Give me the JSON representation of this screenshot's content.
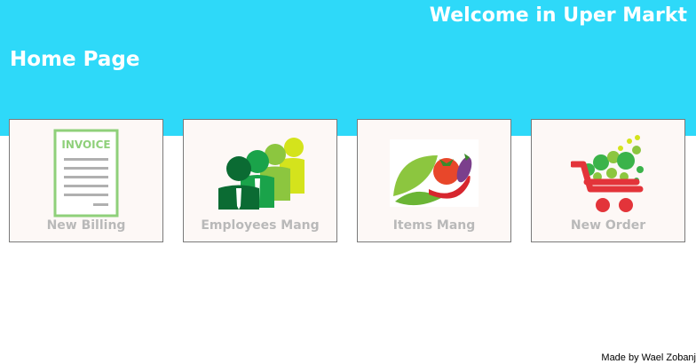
{
  "header": {
    "welcome": "Welcome in Uper Markt",
    "title": "Home Page",
    "background_color": "#2ed9f9"
  },
  "tiles": [
    {
      "label": "New Billing",
      "icon": "invoice-icon",
      "icon_text": "INVOICE"
    },
    {
      "label": "Employees Mang",
      "icon": "employees-icon"
    },
    {
      "label": "Items Mang",
      "icon": "vegetables-icon"
    },
    {
      "label": "New Order",
      "icon": "shopping-cart-icon"
    }
  ],
  "footer": {
    "credit": "Made by Wael Zobanj"
  }
}
